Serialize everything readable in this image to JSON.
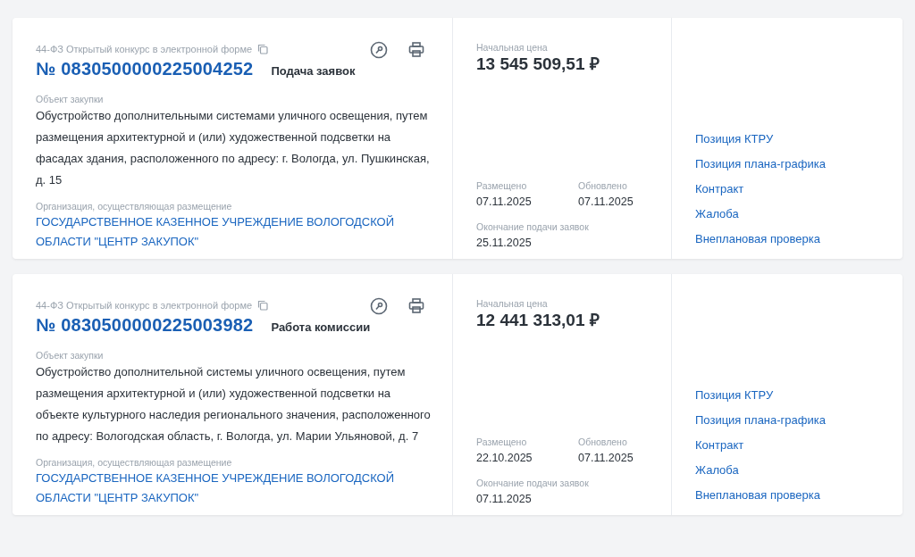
{
  "cards": [
    {
      "law_type": "44-ФЗ Открытый конкурс в электронной форме",
      "number": "№ 0830500000225004252",
      "status": "Подача заявок",
      "object_label": "Объект закупки",
      "object_text": "Обустройство дополнительными системами уличного освещения, путем размещения архитектурной и (или) художественной подсветки на фасадах здания, расположенного по адресу: г. Вологда, ул. Пушкинская, д. 15",
      "org_label": "Организация, осуществляющая размещение",
      "org_name": "ГОСУДАРСТВЕННОЕ КАЗЕННОЕ УЧРЕЖДЕНИЕ ВОЛОГОДСКОЙ ОБЛАСТИ \"ЦЕНТР ЗАКУПОК\"",
      "price_label": "Начальная цена",
      "price": "13 545 509,51 ₽",
      "posted_label": "Размещено",
      "posted": "07.11.2025",
      "updated_label": "Обновлено",
      "updated": "07.11.2025",
      "deadline_label": "Окончание подачи заявок",
      "deadline": "25.11.2025",
      "links": [
        "Позиция КТРУ",
        "Позиция плана-графика",
        "Контракт",
        "Жалоба",
        "Внеплановая проверка"
      ]
    },
    {
      "law_type": "44-ФЗ Открытый конкурс в электронной форме",
      "number": "№ 0830500000225003982",
      "status": "Работа комиссии",
      "object_label": "Объект закупки",
      "object_text": "Обустройство дополнительной системы уличного освещения, путем размещения архитектурной и (или) художественной подсветки на объекте культурного наследия регионального значения, расположенного по адресу: Вологодская область, г. Вологда, ул. Марии Ульяновой, д. 7",
      "org_label": "Организация, осуществляющая размещение",
      "org_name": "ГОСУДАРСТВЕННОЕ КАЗЕННОЕ УЧРЕЖДЕНИЕ ВОЛОГОДСКОЙ ОБЛАСТИ \"ЦЕНТР ЗАКУПОК\"",
      "price_label": "Начальная цена",
      "price": "12 441 313,01 ₽",
      "posted_label": "Размещено",
      "posted": "22.10.2025",
      "updated_label": "Обновлено",
      "updated": "07.11.2025",
      "deadline_label": "Окончание подачи заявок",
      "deadline": "07.11.2025",
      "links": [
        "Позиция КТРУ",
        "Позиция плана-графика",
        "Контракт",
        "Жалоба",
        "Внеплановая проверка"
      ]
    }
  ]
}
